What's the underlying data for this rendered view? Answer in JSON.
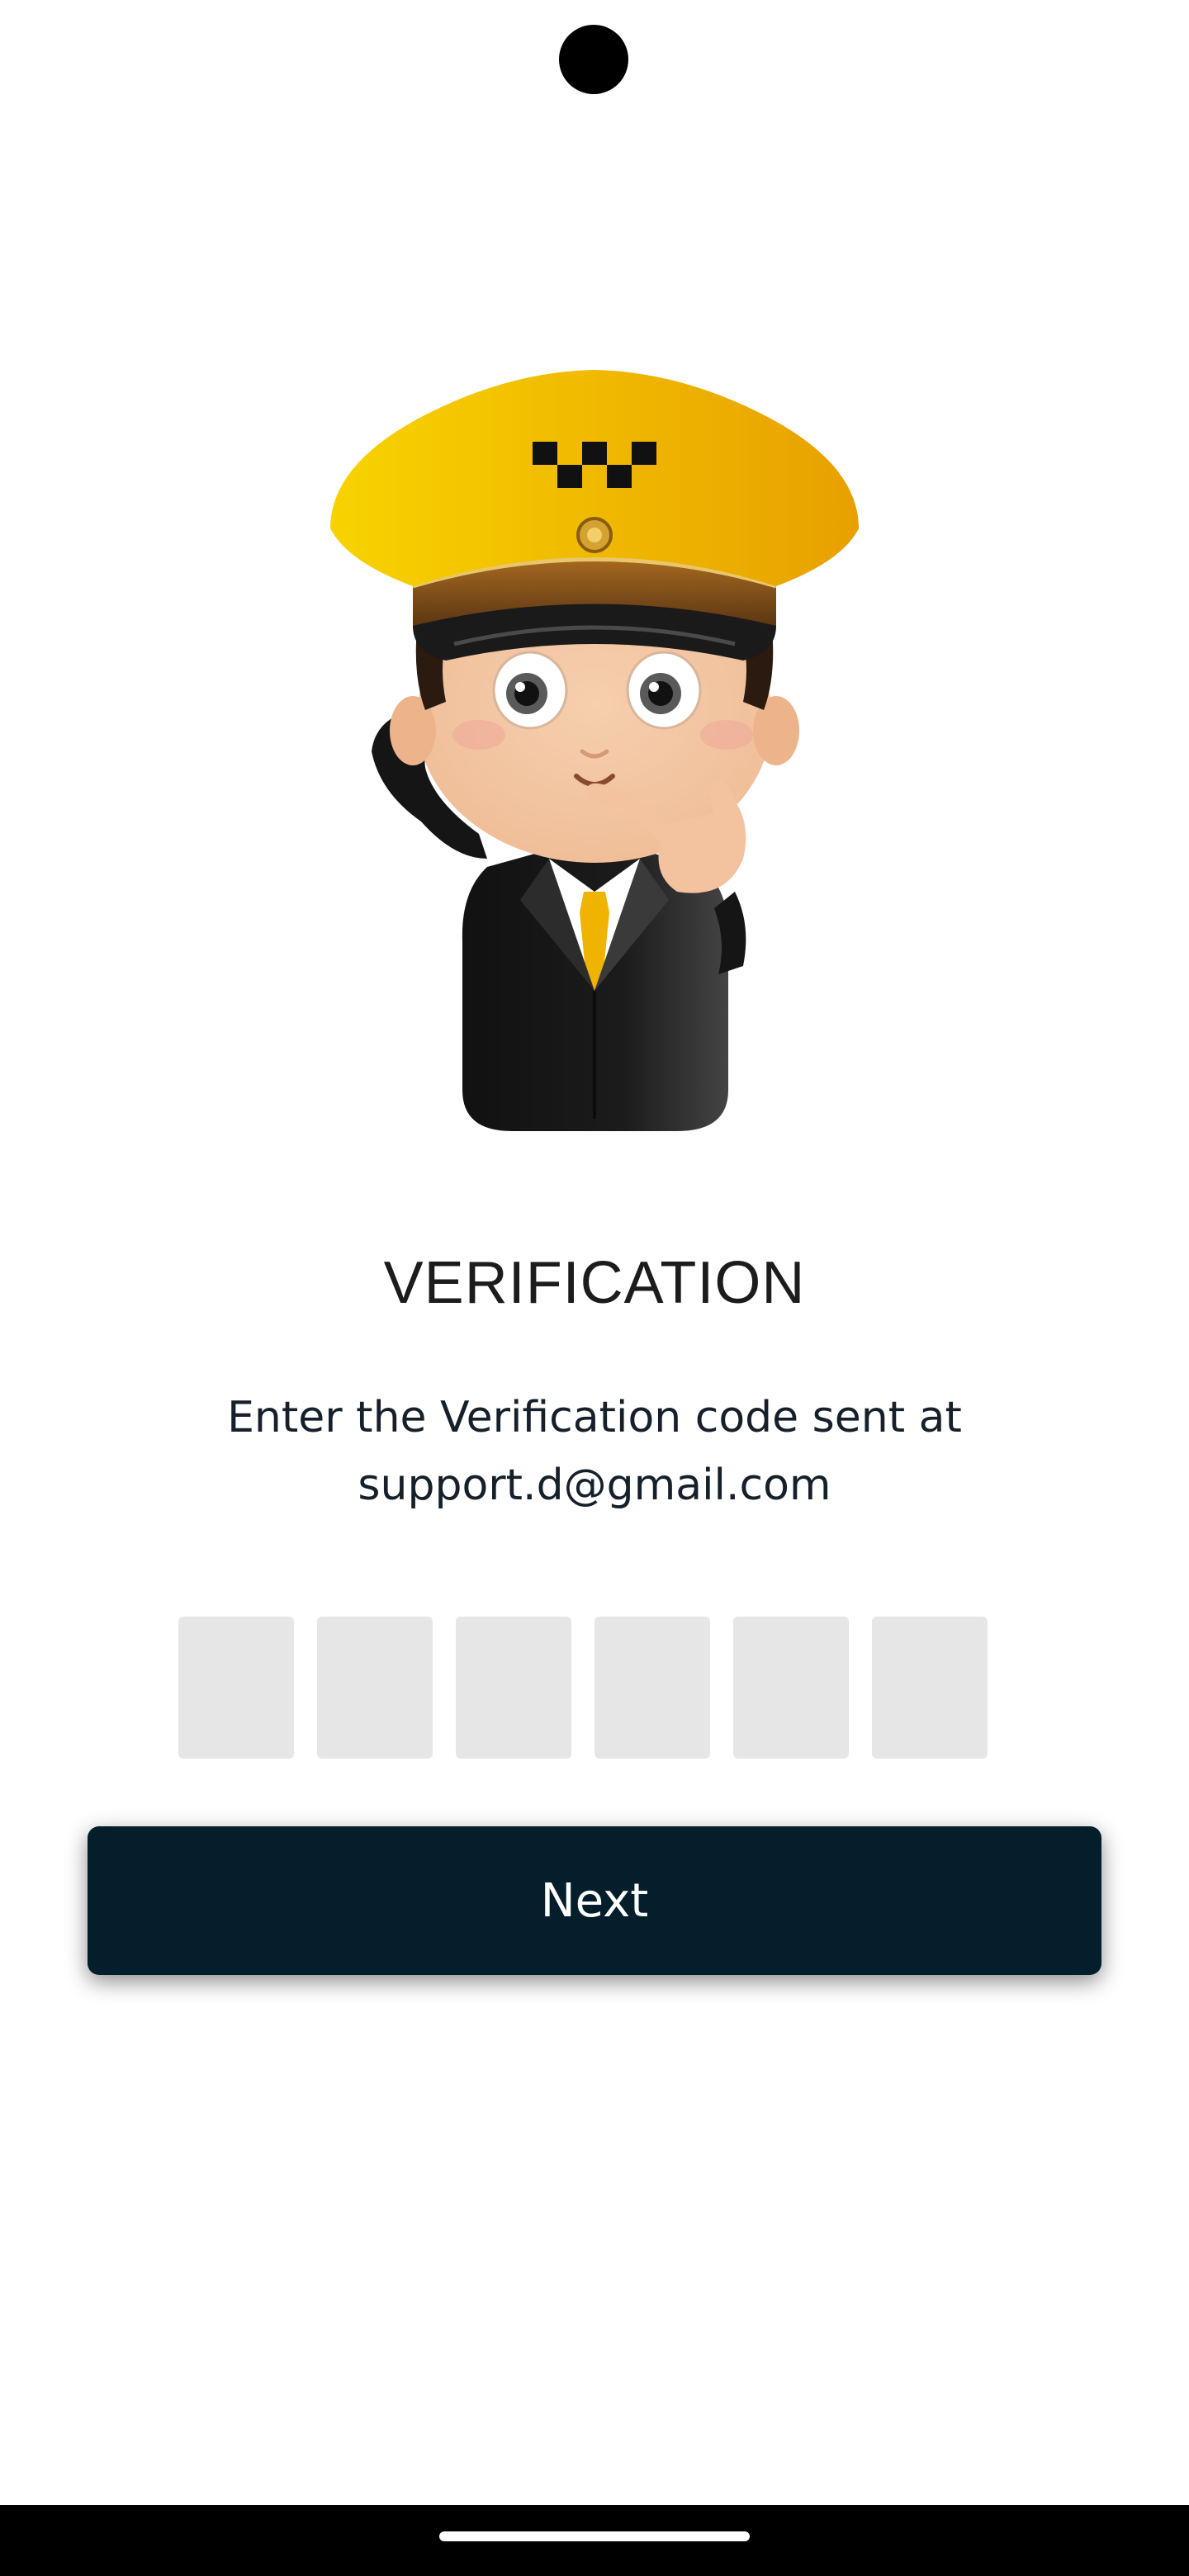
{
  "screen": {
    "title": "VERIFICATION",
    "subtitle": "Enter the Verification code sent at support.d@gmail.com",
    "code_boxes": [
      "",
      "",
      "",
      "",
      "",
      ""
    ],
    "next_label": "Next"
  },
  "icons": {
    "camera": "camera-cutout",
    "illustration": "taxi-driver-illustration",
    "home_indicator": "home-indicator"
  },
  "colors": {
    "button_bg": "#041e2b",
    "code_box_bg": "#e6e6e6",
    "title_text": "#1c1c1c",
    "subtitle_text": "#15202b",
    "cap_yellow": "#f2c200"
  }
}
